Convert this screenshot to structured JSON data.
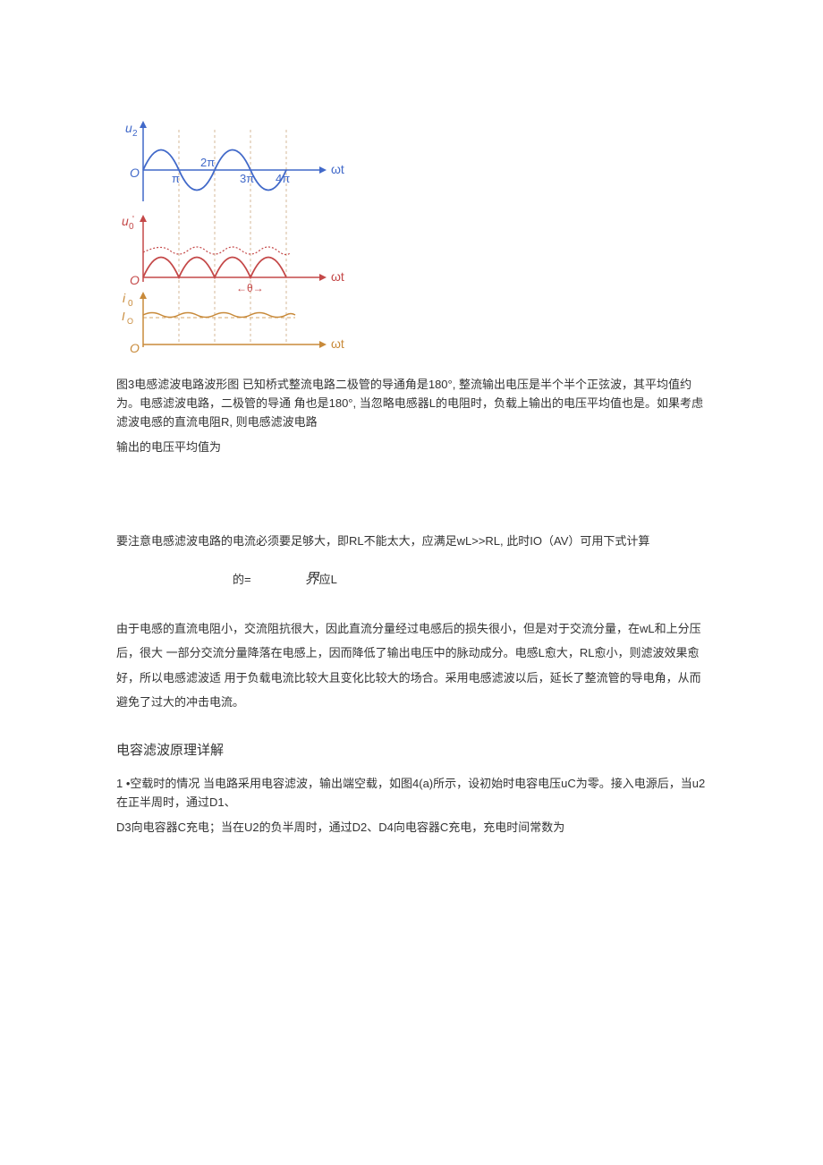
{
  "figure": {
    "axis1_ylabel": "u₂",
    "axis1_xlabel": "ωt",
    "axis1_origin": "O",
    "axis1_ticks": [
      "π",
      "2π",
      "3π",
      "4π"
    ],
    "axis2_ylabel": "u₀'",
    "axis2_xlabel": "ωt",
    "axis2_origin": "O",
    "axis2_theta": "θ",
    "axis3_ylabel": "i₀",
    "axis3_ytick": "I₀",
    "axis3_xlabel": "ωt",
    "axis3_origin": "O"
  },
  "para1": "图3电感滤波电路波形图 已知桥式整流电路二极管的导通角是180°, 整流输出电压是半个半个正弦波，其平均值约为。电感滤波电路，二极管的导通 角也是180°, 当忽略电感器L的电阻时，负载上输出的电压平均值也是。如果考虑滤波电感的直流电阻R, 则电感滤波电路",
  "para2": "输出的电压平均值为",
  "para3": "要注意电感滤波电路的电流必须要足够大，即RL不能太大，应满足wL>>RL, 此时IO（AV）可用下式计算",
  "equation": {
    "left": "的=",
    "right_script": "界",
    "right_normal": "应L"
  },
  "para4": "由于电感的直流电阻小，交流阻抗很大，因此直流分量经过电感后的损失很小，但是对于交流分量，在wL和上分压后，很大 一部分交流分量降落在电感上，因而降低了输出电压中的脉动成分。电感L愈大，RL愈小，则滤波效果愈好，所以电感滤波适 用于负载电流比较大且变化比较大的场合。采用电感滤波以后，延长了整流管的导电角，从而避免了过大的冲击电流。",
  "heading1": "电容滤波原理详解",
  "para5": "1 •空载时的情况 当电路采用电容滤波，输出端空载，如图4(a)所示，设初始时电容电压uC为零。接入电源后，当u2在正半周时，通过D1、",
  "para6": "D3向电容器C充电；当在U2的负半周时，通过D2、D4向电容器C充电，充电时间常数为"
}
